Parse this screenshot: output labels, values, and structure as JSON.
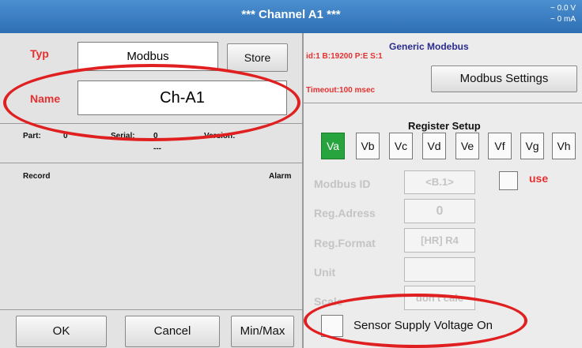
{
  "window": {
    "title": "*** Channel A1 ***",
    "voltage": "~ 0.0 V",
    "current": "~ 0 mA"
  },
  "left": {
    "typ_label": "Typ",
    "typ_value": "Modbus",
    "store_label": "Store",
    "name_label": "Name",
    "name_value": "Ch-A1",
    "part_label": "Part:",
    "part_value": "0",
    "serial_label": "Serial:",
    "serial_value": "0",
    "serial_sub": "---",
    "version_label": "Version:",
    "record_label": "Record",
    "alarm_label": "Alarm"
  },
  "buttons": {
    "ok": "OK",
    "cancel": "Cancel",
    "minmax": "Min/Max"
  },
  "right": {
    "header": "Generic Modebus",
    "info": "id:1 B:19200 P:E S:1",
    "timeout": "Timeout:100 msec",
    "settings_button": "Modbus Settings",
    "register_setup": "Register Setup",
    "registers": [
      "Va",
      "Vb",
      "Vc",
      "Vd",
      "Ve",
      "Vf",
      "Vg",
      "Vh"
    ],
    "active_register": "Va",
    "modbus_id_label": "Modbus ID",
    "modbus_id_value": "<B.1>",
    "use_label": "use",
    "reg_adress_label": "Reg.Adress",
    "reg_adress_value": "0",
    "reg_format_label": "Reg.Format",
    "reg_format_value": "[HR] R4",
    "unit_label": "Unit",
    "unit_value": "",
    "scale_label": "Scale",
    "scale_value": "don't calc",
    "sensor_supply_label": "Sensor Supply Voltage On"
  },
  "colors": {
    "title_bar": "#3a7fc4",
    "active_register": "#27a43d",
    "accent_red": "#e53030",
    "annotation": "#e02020"
  }
}
